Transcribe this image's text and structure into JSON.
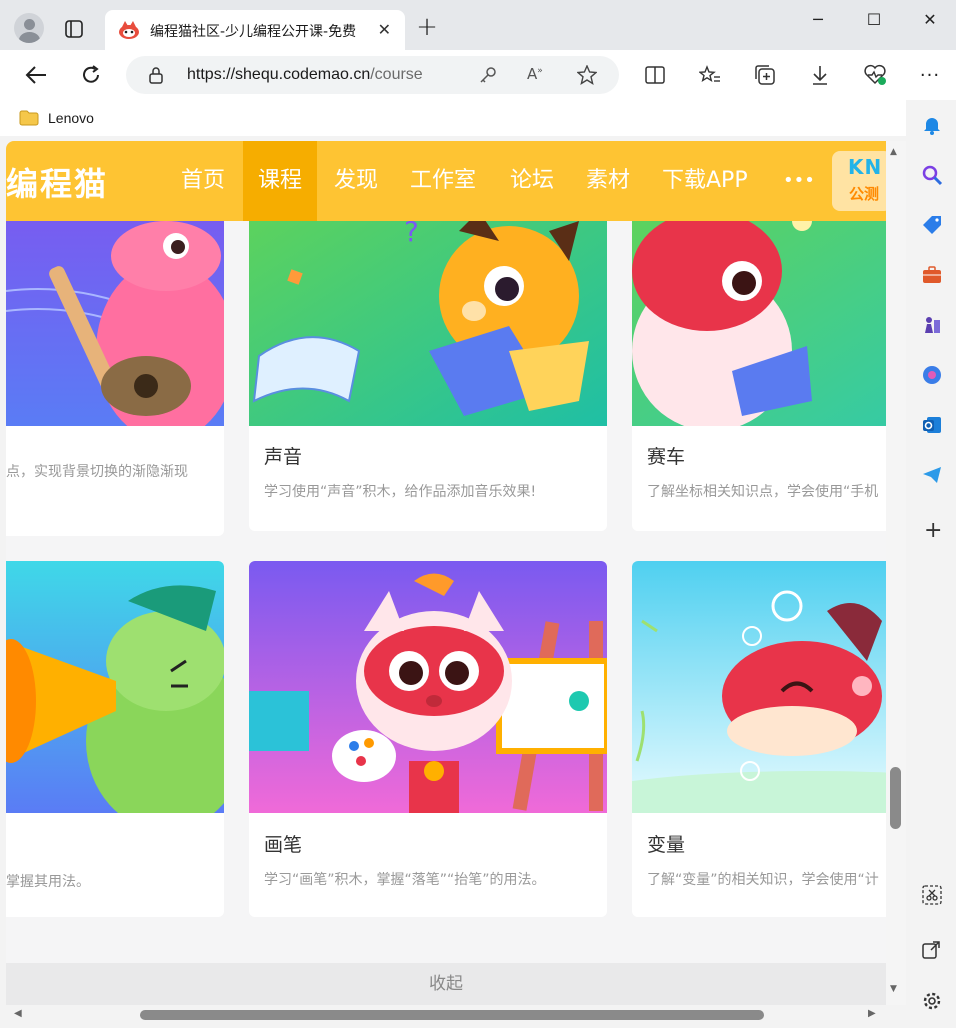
{
  "browser": {
    "tab_title": "编程猫社区-少儿编程公开课-免费",
    "tab_close": "✕",
    "new_tab": "+",
    "url_host": "https://shequ.codemao.cn",
    "url_path": "/course",
    "bookmark": "Lenovo",
    "win_min": "─",
    "win_max": "☐",
    "win_close": "✕"
  },
  "site": {
    "logo": "编程猫",
    "nav": [
      "首页",
      "课程",
      "发现",
      "工作室",
      "论坛",
      "素材",
      "下载APP",
      "•••"
    ],
    "active_nav": "课程",
    "kn_top": "KN",
    "kn_bottom": "公测"
  },
  "cards_row1": [
    {
      "title": "",
      "desc": "点，实现背景切换的渐隐渐现"
    },
    {
      "title": "声音",
      "desc": "学习使用“声音”积木，给作品添加音乐效果!"
    },
    {
      "title": "赛车",
      "desc": "了解坐标相关知识点，学会使用“手机"
    }
  ],
  "cards_row2": [
    {
      "title": "",
      "desc": "掌握其用法。"
    },
    {
      "title": "画笔",
      "desc": "学习“画笔”积木，掌握“落笔”“抬笔”的用法。"
    },
    {
      "title": "变量",
      "desc": "了解“变量”的相关知识，学会使用“计"
    }
  ],
  "collapse_label": "收起",
  "colors": {
    "brand": "#fec433",
    "active": "#f6ad00"
  }
}
